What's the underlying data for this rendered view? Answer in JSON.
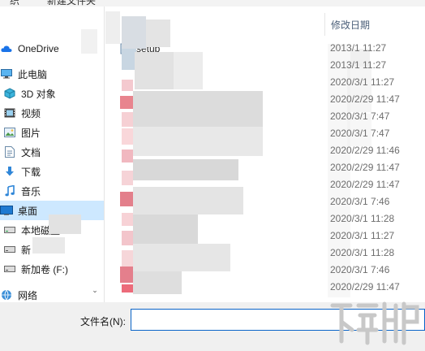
{
  "toolbar": {
    "item1": "织",
    "item2": "新建文件夹"
  },
  "nav": {
    "items": [
      {
        "label": "OneDrive",
        "icon": "cloud-icon"
      },
      {
        "label": "此电脑",
        "icon": "computer-icon"
      },
      {
        "label": "3D 对象",
        "icon": "cube-icon"
      },
      {
        "label": "视频",
        "icon": "video-icon"
      },
      {
        "label": "图片",
        "icon": "picture-icon"
      },
      {
        "label": "文档",
        "icon": "document-icon"
      },
      {
        "label": "下载",
        "icon": "download-icon"
      },
      {
        "label": "音乐",
        "icon": "music-icon"
      },
      {
        "label": "桌面",
        "icon": "desktop-icon"
      },
      {
        "label": "本地磁盘",
        "icon": "drive-icon"
      },
      {
        "label": "新",
        "icon": "drive-icon"
      },
      {
        "label": "新加卷 (F:)",
        "icon": "drive-icon"
      },
      {
        "label": "网络",
        "icon": "network-icon"
      }
    ],
    "selected_index": 8
  },
  "files": {
    "first_name": "setup",
    "column_date": "修改日期",
    "dates": [
      "2013/1 11:27",
      "2013/1 11:27",
      "2020/3/1 11:27",
      "2020/2/29 11:47",
      "2020/3/1 7:47",
      "2020/3/1 7:47",
      "2020/2/29 11:46",
      "2020/2/29 11:47",
      "2020/2/29 11:47",
      "2020/3/1 7:46",
      "2020/3/1 11:28",
      "2020/3/1 11:27",
      "2020/3/1 11:28",
      "2020/3/1 7:46",
      "2020/2/29 11:47"
    ]
  },
  "footer": {
    "filename_label": "文件名(N):",
    "filename_value": ""
  },
  "colors": {
    "accent": "#0a64c8",
    "selected": "#cde8ff",
    "pink": "#e8848e"
  }
}
